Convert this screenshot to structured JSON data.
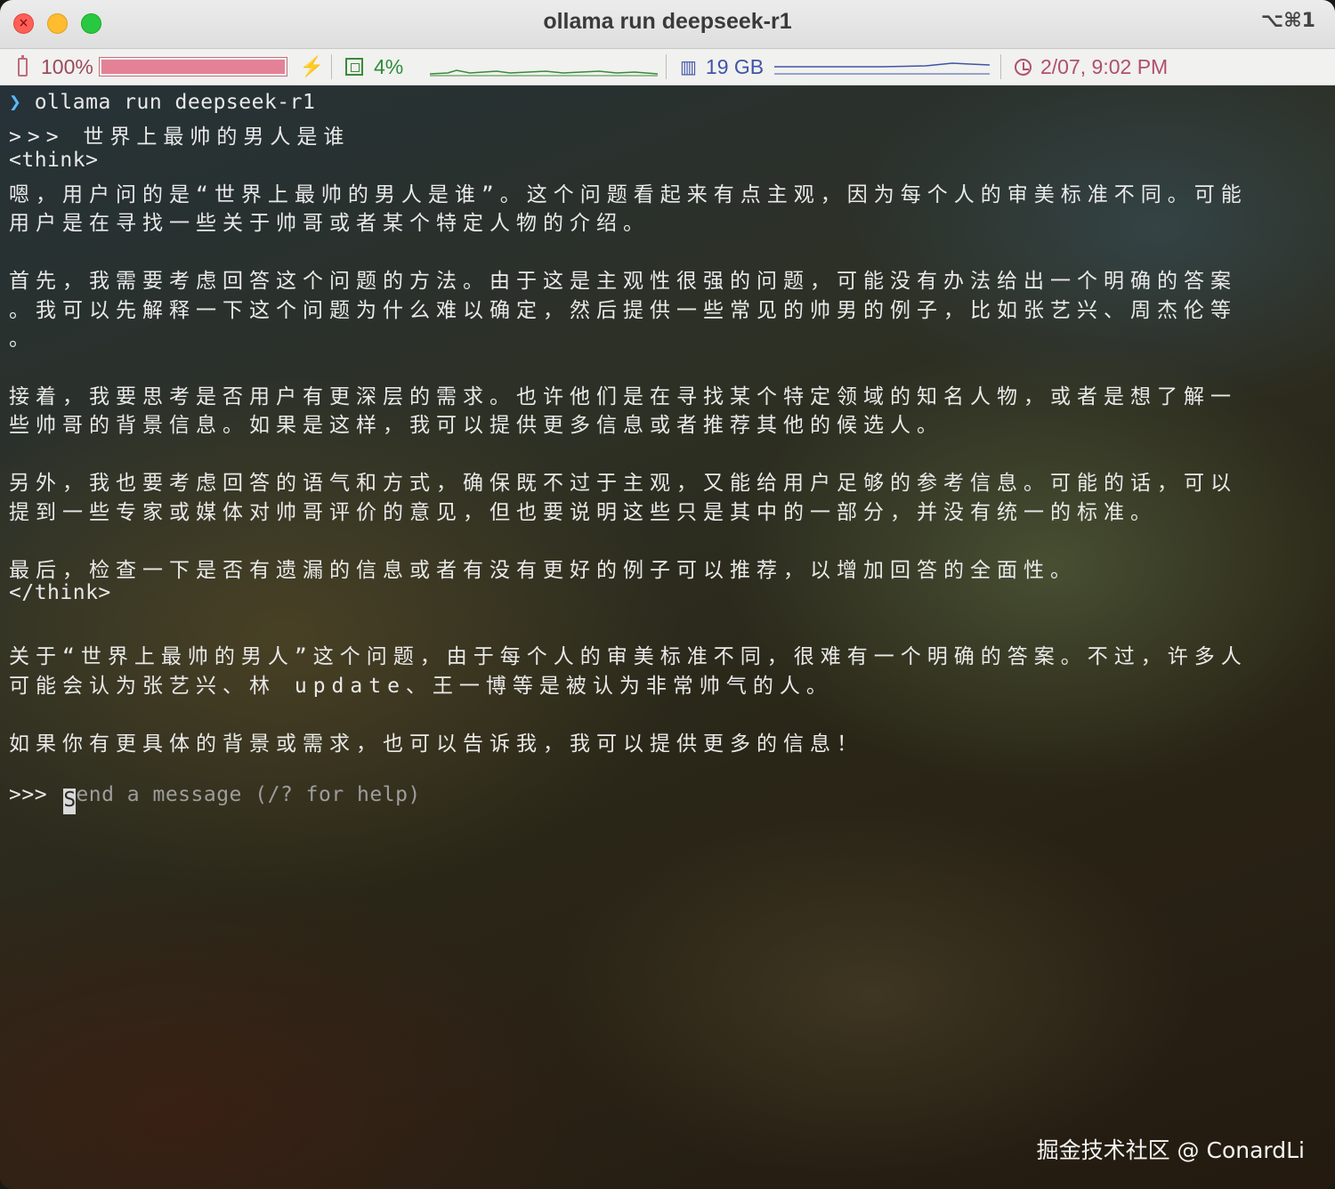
{
  "window": {
    "title": "ollama run deepseek-r1",
    "shortcut": "⌥⌘1",
    "controls": [
      "close",
      "minimize",
      "zoom"
    ]
  },
  "statusbar": {
    "battery": {
      "text": "100%",
      "level": 1.0,
      "charging": true
    },
    "cpu": {
      "text": "4%"
    },
    "memory": {
      "text": "19 GB"
    },
    "clock": {
      "text": "2/07, 9:02 PM"
    }
  },
  "terminal": {
    "lines": [
      {
        "prompt": "❯",
        "text": " ollama run deepseek-r1"
      },
      {
        "text": ">>> 世界上最帅的男人是谁"
      },
      {
        "text": "<think>"
      },
      {
        "text": "嗯，用户问的是“世界上最帅的男人是谁”。这个问题看起来有点主观，因为每个人的审美标准不同。可能"
      },
      {
        "text": "用户是在寻找一些关于帅哥或者某个特定人物的介绍。"
      },
      {
        "text": "首先，我需要考虑回答这个问题的方法。由于这是主观性很强的问题，可能没有办法给出一个明确的答案"
      },
      {
        "text": "。我可以先解释一下这个问题为什么难以确定，然后提供一些常见的帅男的例子，比如张艺兴、周杰伦等"
      },
      {
        "text": "。"
      },
      {
        "text": "接着，我要思考是否用户有更深层的需求。也许他们是在寻找某个特定领域的知名人物，或者是想了解一"
      },
      {
        "text": "些帅哥的背景信息。如果是这样，我可以提供更多信息或者推荐其他的候选人。"
      },
      {
        "text": "另外，我也要考虑回答的语气和方式，确保既不过于主观，又能给用户足够的参考信息。可能的话，可以"
      },
      {
        "text": "提到一些专家或媒体对帅哥评价的意见，但也要说明这些只是其中的一部分，并没有统一的标准。"
      },
      {
        "text": "最后，检查一下是否有遗漏的信息或者有没有更好的例子可以推荐，以增加回答的全面性。"
      },
      {
        "text": "</think>"
      },
      {
        "text": "关于“世界上最帅的男人”这个问题，由于每个人的审美标准不同，很难有一个明确的答案。不过，许多人"
      },
      {
        "text": "可能会认为张艺兴、林 update、王一博等是被认为非常帅气的人。"
      },
      {
        "text": "如果你有更具体的背景或需求，也可以告诉我，我可以提供更多的信息！"
      }
    ],
    "input": {
      "prompt": ">>> ",
      "cursor_char": "S",
      "placeholder": "end a message (/? for help)"
    }
  },
  "watermark": "掘金技术社区 @ ConardLi"
}
